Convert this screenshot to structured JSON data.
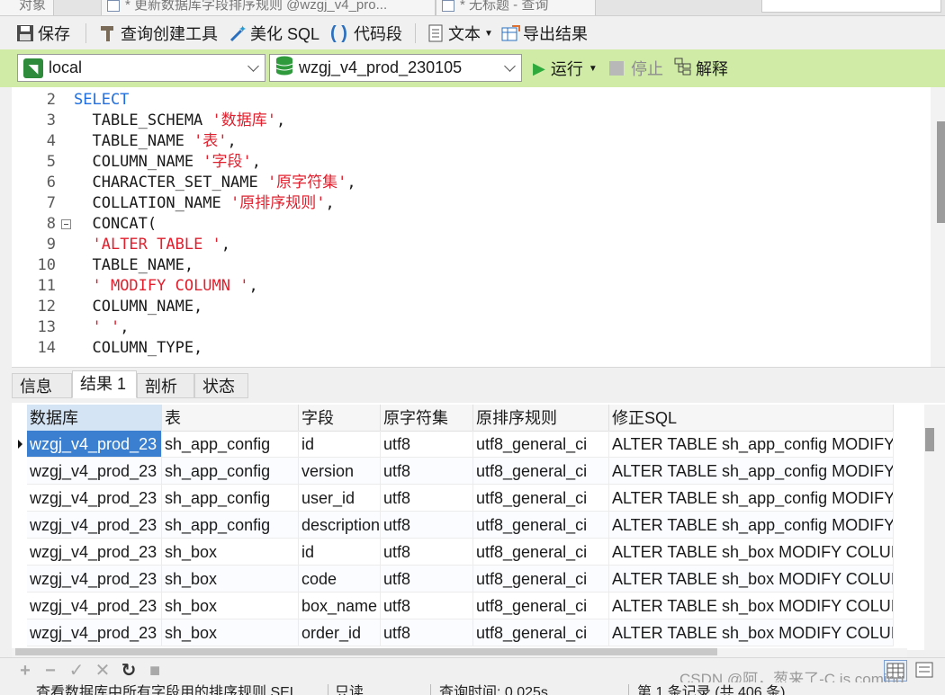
{
  "tabs": [
    {
      "label": "对象"
    },
    {
      "label": "* 更新数据库字段排序规则 @wzgj_v4_pro..."
    },
    {
      "label": "* 无标题 - 查询"
    }
  ],
  "toolbar": {
    "save": "保存",
    "query_builder": "查询创建工具",
    "beautify_sql": "美化 SQL",
    "code_snippet": "代码段",
    "text": "文本",
    "export_result": "导出结果"
  },
  "runbar": {
    "connection": "local",
    "database": "wzgj_v4_prod_230105",
    "run": "运行",
    "stop": "停止",
    "explain": "解释"
  },
  "editor": {
    "lines": [
      {
        "no": "2",
        "segs": [
          {
            "t": "SELECT",
            "c": "kw"
          }
        ]
      },
      {
        "no": "3",
        "segs": [
          {
            "t": "  TABLE_SCHEMA ",
            "c": ""
          },
          {
            "t": "'数据库'",
            "c": "str"
          },
          {
            "t": ",",
            "c": ""
          }
        ]
      },
      {
        "no": "4",
        "segs": [
          {
            "t": "  TABLE_NAME ",
            "c": ""
          },
          {
            "t": "'表'",
            "c": "str"
          },
          {
            "t": ",",
            "c": ""
          }
        ]
      },
      {
        "no": "5",
        "segs": [
          {
            "t": "  COLUMN_NAME ",
            "c": ""
          },
          {
            "t": "'字段'",
            "c": "str"
          },
          {
            "t": ",",
            "c": ""
          }
        ]
      },
      {
        "no": "6",
        "segs": [
          {
            "t": "  CHARACTER_SET_NAME ",
            "c": ""
          },
          {
            "t": "'原字符集'",
            "c": "str"
          },
          {
            "t": ",",
            "c": ""
          }
        ]
      },
      {
        "no": "7",
        "segs": [
          {
            "t": "  COLLATION_NAME ",
            "c": ""
          },
          {
            "t": "'原排序规则'",
            "c": "str"
          },
          {
            "t": ",",
            "c": ""
          }
        ]
      },
      {
        "no": "8",
        "segs": [
          {
            "t": "  CONCAT(",
            "c": ""
          }
        ],
        "fold": true
      },
      {
        "no": "9",
        "segs": [
          {
            "t": "  ",
            "c": ""
          },
          {
            "t": "'ALTER TABLE '",
            "c": "str"
          },
          {
            "t": ",",
            "c": ""
          }
        ]
      },
      {
        "no": "10",
        "segs": [
          {
            "t": "  TABLE_NAME,",
            "c": ""
          }
        ]
      },
      {
        "no": "11",
        "segs": [
          {
            "t": "  ",
            "c": ""
          },
          {
            "t": "' MODIFY COLUMN '",
            "c": "str"
          },
          {
            "t": ",",
            "c": ""
          }
        ]
      },
      {
        "no": "12",
        "segs": [
          {
            "t": "  COLUMN_NAME,",
            "c": ""
          }
        ]
      },
      {
        "no": "13",
        "segs": [
          {
            "t": "  ",
            "c": ""
          },
          {
            "t": "' '",
            "c": "str"
          },
          {
            "t": ",",
            "c": ""
          }
        ]
      },
      {
        "no": "14",
        "segs": [
          {
            "t": "  COLUMN_TYPE,",
            "c": ""
          }
        ]
      }
    ]
  },
  "result_tabs": [
    "信息",
    "结果 1",
    "剖析",
    "状态"
  ],
  "grid": {
    "columns": [
      "数据库",
      "表",
      "字段",
      "原字符集",
      "原排序规则",
      "修正SQL"
    ],
    "rows": [
      [
        "wzgj_v4_prod_23",
        "sh_app_config",
        "id",
        "utf8",
        "utf8_general_ci",
        "ALTER TABLE sh_app_config MODIFY"
      ],
      [
        "wzgj_v4_prod_23",
        "sh_app_config",
        "version",
        "utf8",
        "utf8_general_ci",
        "ALTER TABLE sh_app_config MODIFY"
      ],
      [
        "wzgj_v4_prod_23",
        "sh_app_config",
        "user_id",
        "utf8",
        "utf8_general_ci",
        "ALTER TABLE sh_app_config MODIFY"
      ],
      [
        "wzgj_v4_prod_23",
        "sh_app_config",
        "description",
        "utf8",
        "utf8_general_ci",
        "ALTER TABLE sh_app_config MODIFY"
      ],
      [
        "wzgj_v4_prod_23",
        "sh_box",
        "id",
        "utf8",
        "utf8_general_ci",
        "ALTER TABLE sh_box MODIFY COLUI"
      ],
      [
        "wzgj_v4_prod_23",
        "sh_box",
        "code",
        "utf8",
        "utf8_general_ci",
        "ALTER TABLE sh_box MODIFY COLUI"
      ],
      [
        "wzgj_v4_prod_23",
        "sh_box",
        "box_name",
        "utf8",
        "utf8_general_ci",
        "ALTER TABLE sh_box MODIFY COLUI"
      ],
      [
        "wzgj_v4_prod_23",
        "sh_box",
        "order_id",
        "utf8",
        "utf8_general_ci",
        "ALTER TABLE sh_box MODIFY COLUI"
      ]
    ]
  },
  "status": {
    "sql": "查看数据库中所有字段用的排序规则 SEL",
    "mode": "只读",
    "query_time": "查询时间: 0.025s",
    "record": "第 1 条记录 (共 406 条)"
  },
  "watermark": "CSDN @阿，葱来了-C is coming",
  "colors": {
    "run_bar": "#cfeba5",
    "keyword": "#1f6fe0",
    "string": "#e0202e",
    "selection": "#3a7fd0"
  }
}
